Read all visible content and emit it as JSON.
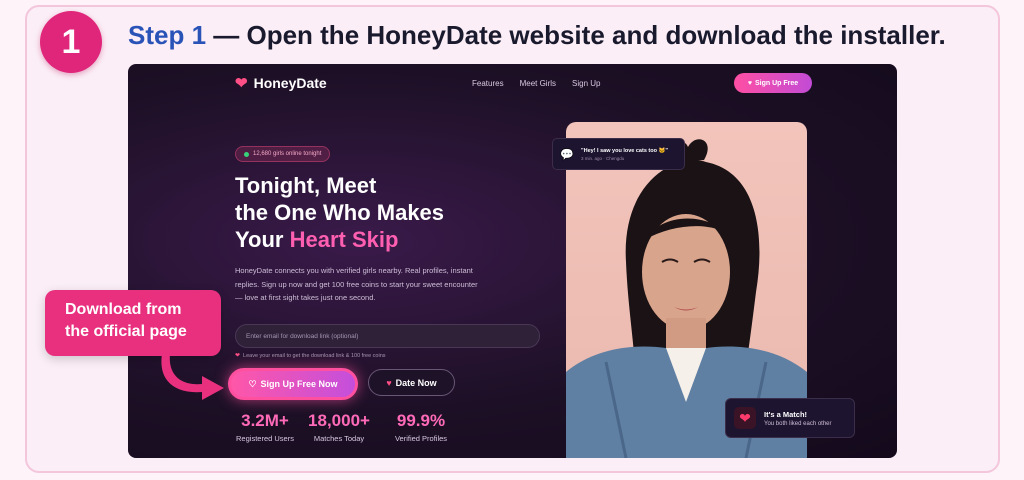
{
  "step": {
    "number": "1",
    "label": "Step 1",
    "title": " — Open the HoneyDate website and download the installer."
  },
  "site": {
    "brand": "HoneyDate",
    "nav_links": [
      "Features",
      "Meet Girls",
      "Sign Up"
    ],
    "nav_cta": "Sign Up Free",
    "online_badge": "12,680 girls online tonight",
    "hero": {
      "line1": "Tonight, Meet",
      "line2": "the One Who Makes",
      "line3_prefix": "Your ",
      "line3_accent": "Heart Skip"
    },
    "hero_text": "HoneyDate connects you with verified girls nearby. Real profiles, instant replies. Sign up now and get 100 free coins to start your sweet encounter — love at first sight takes just one second.",
    "email_placeholder": "Enter email for download link (optional)",
    "email_hint": "Leave your email to get the download link & 100 free coins",
    "primary_button": "Sign Up Free Now",
    "secondary_button": "Date Now",
    "stats": [
      {
        "value": "3.2M+",
        "label": "Registered Users"
      },
      {
        "value": "18,000+",
        "label": "Matches Today"
      },
      {
        "value": "99.9%",
        "label": "Verified Profiles"
      }
    ],
    "message_bubble": {
      "title": "\"Hey! I saw you love cats too 🐱\"",
      "subtitle": "3 min. ago · Chengdu"
    },
    "match_card": {
      "title": "It's a Match!",
      "subtitle": "You both liked each other"
    }
  },
  "callout": {
    "line1": "Download from",
    "line2": "the official page"
  },
  "colors": {
    "accent_pink": "#e0267a",
    "heading_blue": "#2a53b8",
    "site_background": "#1d1026",
    "stat_pink": "#ff6ab8"
  },
  "icons": {
    "brand": "heart-icon",
    "message": "chat-bubble-icon",
    "match": "heart-icon",
    "online": "green-dot-icon"
  }
}
